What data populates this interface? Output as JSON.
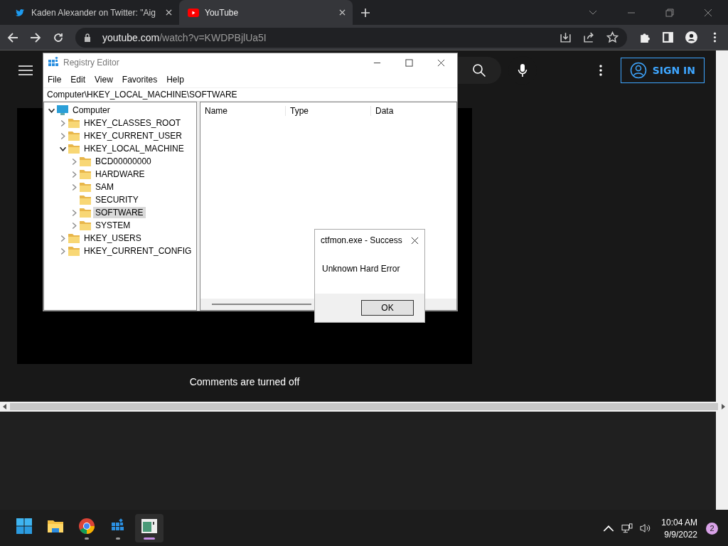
{
  "browser": {
    "tabs": [
      {
        "kind": "twitter",
        "title": "Kaden Alexander on Twitter: \"Aig",
        "selected": false
      },
      {
        "kind": "youtube",
        "title": "YouTube",
        "selected": true
      }
    ],
    "address": {
      "host": "youtube.com",
      "path": "/watch?v=KWDPBjlUa5I"
    }
  },
  "youtube": {
    "sign_in": "SIGN IN",
    "comments_notice": "Comments are turned off"
  },
  "registry_editor": {
    "title": "Registry Editor",
    "menu": [
      "File",
      "Edit",
      "View",
      "Favorites",
      "Help"
    ],
    "address": "Computer\\HKEY_LOCAL_MACHINE\\SOFTWARE",
    "tree": [
      {
        "label": "Computer",
        "expanded": true,
        "has_subkeys": true,
        "selected": false,
        "children": [
          {
            "label": "HKEY_CLASSES_ROOT",
            "expanded": false,
            "has_subkeys": true,
            "selected": false
          },
          {
            "label": "HKEY_CURRENT_USER",
            "expanded": false,
            "has_subkeys": true,
            "selected": false
          },
          {
            "label": "HKEY_LOCAL_MACHINE",
            "expanded": true,
            "has_subkeys": true,
            "selected": false,
            "children": [
              {
                "label": "BCD00000000",
                "expanded": false,
                "has_subkeys": true,
                "selected": false
              },
              {
                "label": "HARDWARE",
                "expanded": false,
                "has_subkeys": true,
                "selected": false
              },
              {
                "label": "SAM",
                "expanded": false,
                "has_subkeys": true,
                "selected": false
              },
              {
                "label": "SECURITY",
                "expanded": false,
                "has_subkeys": false,
                "selected": false
              },
              {
                "label": "SOFTWARE",
                "expanded": false,
                "has_subkeys": true,
                "selected": true
              },
              {
                "label": "SYSTEM",
                "expanded": false,
                "has_subkeys": true,
                "selected": false
              }
            ]
          },
          {
            "label": "HKEY_USERS",
            "expanded": false,
            "has_subkeys": true,
            "selected": false
          },
          {
            "label": "HKEY_CURRENT_CONFIG",
            "expanded": false,
            "has_subkeys": true,
            "selected": false
          }
        ]
      }
    ],
    "columns": [
      "Name",
      "Type",
      "Data"
    ]
  },
  "dialog": {
    "title": "ctfmon.exe - Success",
    "message": "Unknown Hard Error",
    "button": "OK"
  },
  "taskbar": {
    "apps": [
      {
        "kind": "start",
        "running": false,
        "selected": false
      },
      {
        "kind": "explorer",
        "running": false,
        "selected": false
      },
      {
        "kind": "chrome",
        "running": true,
        "selected": false
      },
      {
        "kind": "regedit",
        "running": true,
        "selected": false
      },
      {
        "kind": "window",
        "running": true,
        "selected": true
      }
    ],
    "time": "10:04 AM",
    "date": "9/9/2022",
    "notification_count": "2"
  }
}
